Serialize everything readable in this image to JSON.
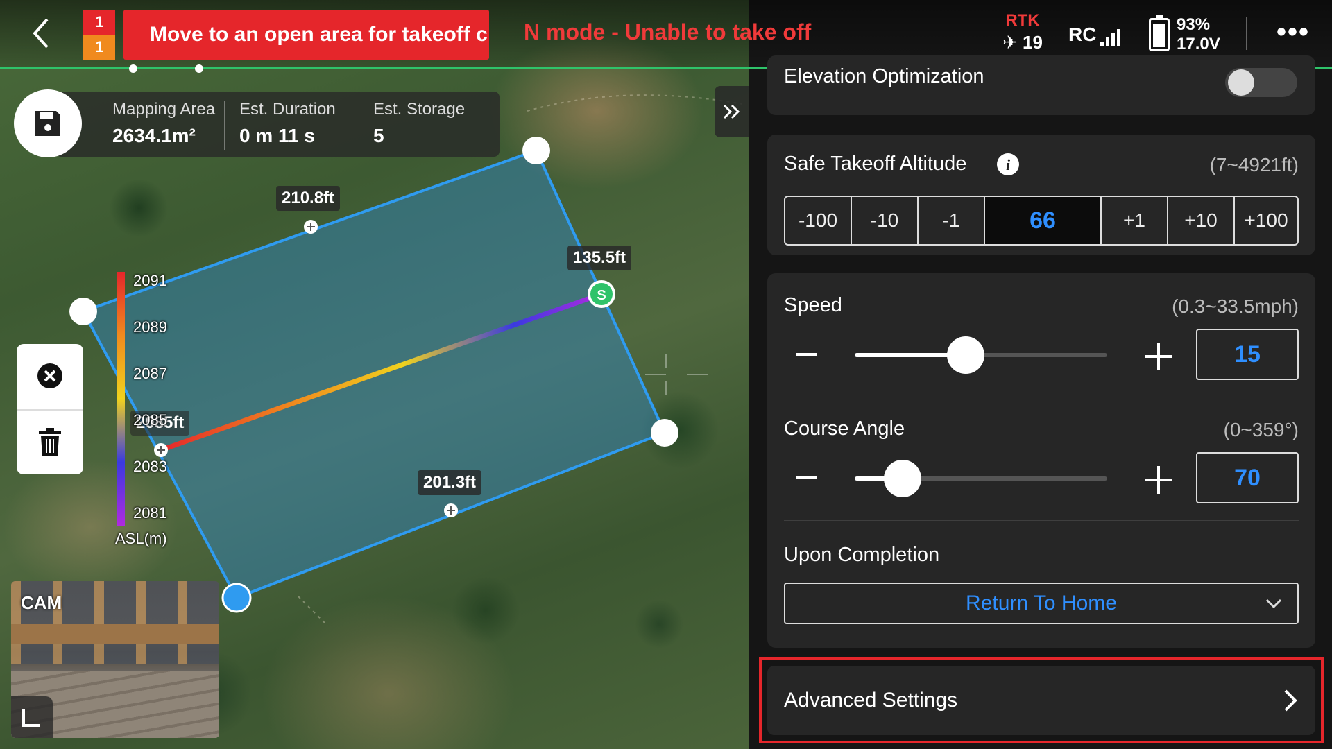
{
  "topbar": {
    "badge_top": "1",
    "badge_bottom": "1",
    "warning": "Move to an open area for takeoff c",
    "mode_status": "N mode - Unable to take off",
    "rtk_label": "RTK",
    "satellite_count": "19",
    "rc_label": "RC",
    "battery_percent": "93%",
    "battery_voltage": "17.0V",
    "battery_level": 0.93,
    "more_label": "•••"
  },
  "stats": {
    "mapping_area_label": "Mapping Area",
    "mapping_area_value": "2634.1m²",
    "duration_label": "Est. Duration",
    "duration_value": "0 m 11 s",
    "storage_label": "Est. Storage",
    "storage_value": "5"
  },
  "map": {
    "edge_labels": [
      "210.8ft",
      "135.5ft",
      "201.3ft",
      "2085ft"
    ],
    "start_marker": "S",
    "elevation_ticks": [
      "2091",
      "2089",
      "2087",
      "2085",
      "2083",
      "2081"
    ],
    "elevation_unit": "ASL(m)",
    "camera_label": "CAM",
    "colors": {
      "polygon_edge": "#2f9bf0",
      "polygon_fill": "#2f8ad0",
      "start_marker": "#2fc36a",
      "gradient": [
        "#e5262b",
        "#f08a1e",
        "#f0d21e",
        "#3a3ae0",
        "#b02ae0"
      ]
    }
  },
  "panel": {
    "elevation_opt_label": "Elevation Optimization",
    "takeoff": {
      "title": "Safe Takeoff Altitude",
      "range": "(7~4921ft)",
      "steps": [
        "-100",
        "-10",
        "-1",
        "66",
        "+1",
        "+10",
        "+100"
      ]
    },
    "speed": {
      "title": "Speed",
      "range": "(0.3~33.5mph)",
      "value": "15",
      "fraction": 0.44
    },
    "course": {
      "title": "Course Angle",
      "range": "(0~359°)",
      "value": "70",
      "fraction": 0.19
    },
    "completion": {
      "title": "Upon Completion",
      "selected": "Return To Home"
    },
    "advanced_label": "Advanced Settings",
    "accent": "#2f8fff",
    "highlight": "#e5262b"
  }
}
